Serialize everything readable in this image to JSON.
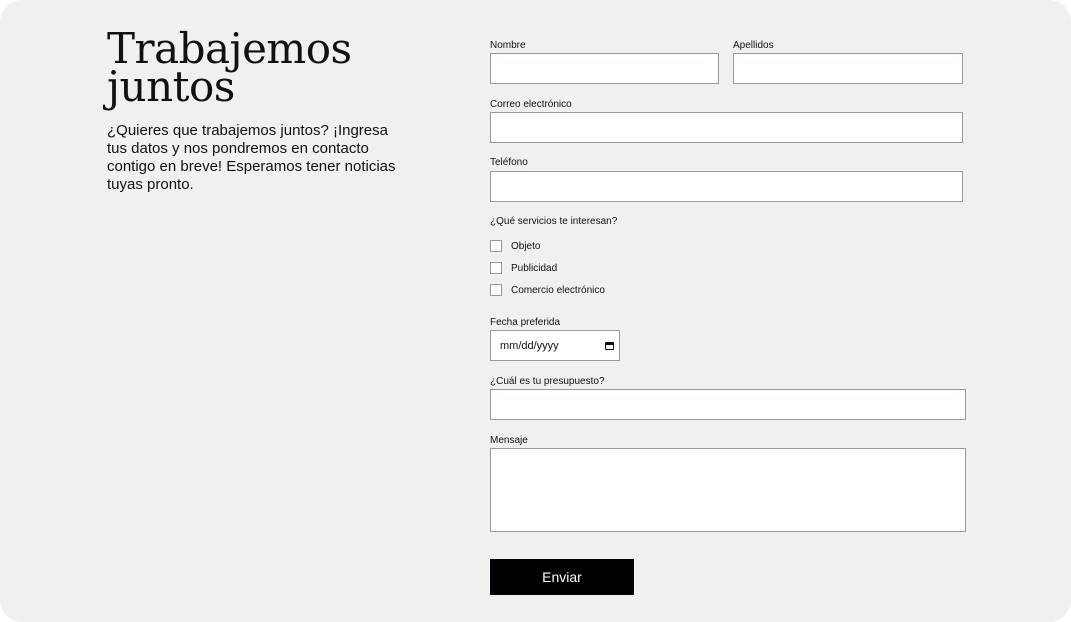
{
  "intro": {
    "title_line1": "Trabajemos",
    "title_line2": "juntos",
    "description": "¿Quieres que trabajemos juntos? ¡Ingresa tus datos y nos pondremos en contacto contigo en breve! Esperamos tener noticias tuyas pronto."
  },
  "form": {
    "first_name": {
      "label": "Nombre",
      "value": ""
    },
    "last_name": {
      "label": "Apellidos",
      "value": ""
    },
    "email": {
      "label": "Correo electrónico",
      "value": ""
    },
    "phone": {
      "label": "Teléfono",
      "value": ""
    },
    "services": {
      "label": "¿Qué servicios te interesan?",
      "options": [
        "Objeto",
        "Publicidad",
        "Comercio electrónico"
      ]
    },
    "date": {
      "label": "Fecha preferida",
      "placeholder": "mm/dd/yyyy",
      "icon": "calendar-icon"
    },
    "budget": {
      "label": "¿Cuál es tu presupuesto?",
      "value": ""
    },
    "message": {
      "label": "Mensaje",
      "value": ""
    },
    "submit_label": "Enviar"
  },
  "colors": {
    "background": "#f1f0ec",
    "button": "#000000",
    "button_text": "#ffffff",
    "field_border": "#9a9a9a"
  }
}
